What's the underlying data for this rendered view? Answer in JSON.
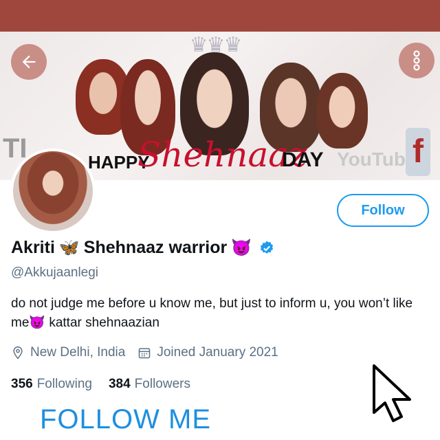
{
  "banner": {
    "happy": "HAPPY",
    "name": "Shehnaaz",
    "day": "DAY",
    "youtube": "YouTube",
    "facebook_glyph": "f",
    "tiktok_glyph": "TI"
  },
  "header": {
    "back_icon": "back-arrow-icon",
    "more_icon": "more-vertical-icon"
  },
  "profile": {
    "follow_label": "Follow",
    "name_first": "Akriti",
    "name_emoji_1": "🦋",
    "name_rest": "Shehnaaz warrior",
    "name_emoji_2": "😈",
    "handle": "@Akkujaanlegi",
    "bio": "do not judge me before u know me, but just to inform u, you won’t like me😈     kattar shehnaazian",
    "location": "New Delhi, India",
    "joined": "Joined January 2021",
    "following_count": "356",
    "following_label": "Following",
    "followers_count": "384",
    "followers_label": "Followers"
  },
  "overlay": {
    "follow_me": "FOLLOW ME"
  },
  "colors": {
    "top_bar": "#a0473d",
    "accent": "#1d9bf0",
    "verified": "#1d9bf0"
  }
}
